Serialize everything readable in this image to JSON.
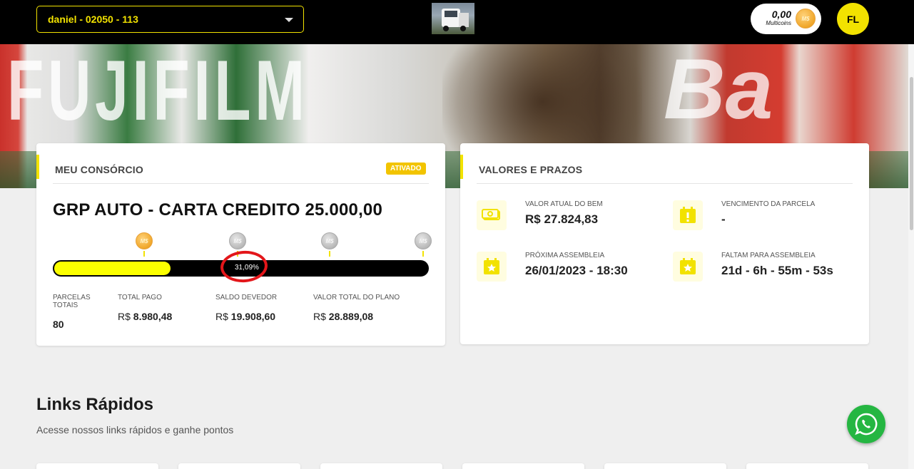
{
  "topbar": {
    "group_select": "daniel - 02050 - 113",
    "coins_value": "0,00",
    "coins_label": "Multicoins",
    "coin_symbol": "M$",
    "avatar_initials": "FL"
  },
  "consorcio": {
    "section_title": "MEU CONSÓRCIO",
    "status_badge": "ATIVADO",
    "plan_title": "GRP AUTO - CARTA CREDITO 25.000,00",
    "progress_percent_label": "31,09%",
    "progress_fraction": 0.3109,
    "milestones": [
      {
        "symbol": "M$",
        "state": "gold"
      },
      {
        "symbol": "M$",
        "state": "silver"
      },
      {
        "symbol": "M$",
        "state": "silver"
      },
      {
        "symbol": "M$",
        "state": "silver"
      }
    ],
    "stats": {
      "parcelas_label": "PARCELAS TOTAIS",
      "parcelas_value": "80",
      "total_pago_label": "TOTAL PAGO",
      "total_pago_currency": "R$",
      "total_pago_value": "8.980,48",
      "saldo_label": "SALDO DEVEDOR",
      "saldo_currency": "R$",
      "saldo_value": "19.908,60",
      "valor_plano_label": "VALOR TOTAL DO PLANO",
      "valor_plano_currency": "R$",
      "valor_plano_value": "28.889,08"
    }
  },
  "valores": {
    "section_title": "VALORES E PRAZOS",
    "valor_bem_label": "VALOR ATUAL DO BEM",
    "valor_bem_value": "R$ 27.824,83",
    "vencimento_label": "VENCIMENTO DA PARCELA",
    "vencimento_value": "-",
    "assembleia_label": "PRÓXIMA ASSEMBLEIA",
    "assembleia_value": "26/01/2023 - 18:30",
    "faltam_label": "FALTAM PARA ASSEMBLEIA",
    "faltam_value": "21d - 6h - 55m - 53s"
  },
  "links": {
    "title": "Links Rápidos",
    "subtitle": "Acesse nossos links rápidos e ganhe pontos"
  },
  "colors": {
    "accent_yellow": "#f2e200",
    "progress_fill": "#fbff00",
    "badge": "#f2c400",
    "annotation_red": "#e3161a",
    "whatsapp_green": "#25b642"
  },
  "icons": {
    "whatsapp": "whatsapp-icon",
    "money": "money-bill-icon",
    "alert_calendar": "calendar-alert-icon",
    "star_calendar": "calendar-star-icon"
  }
}
